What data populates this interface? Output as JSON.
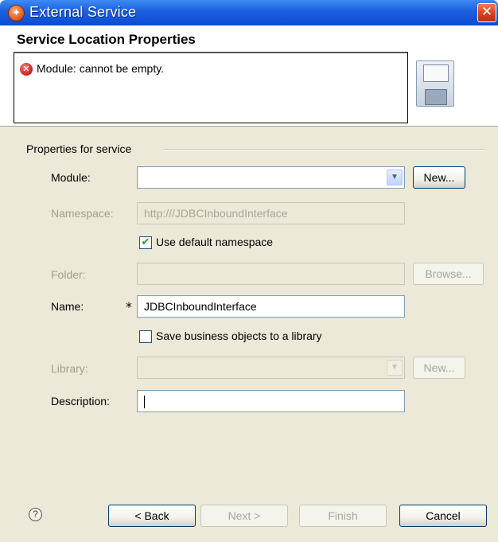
{
  "window": {
    "title": "External Service",
    "close_symbol": "✕",
    "app_icon_symbol": "✦"
  },
  "header": {
    "title": "Service Location Properties",
    "error_message": "Module: cannot be empty."
  },
  "group": {
    "label": "Properties for service"
  },
  "form": {
    "module_label": "Module:",
    "module_value": "",
    "module_new_button": "New...",
    "namespace_label": "Namespace:",
    "namespace_value": "http:///JDBCInboundInterface",
    "use_default_namespace_label": "Use default namespace",
    "use_default_namespace_checked": true,
    "folder_label": "Folder:",
    "folder_value": "",
    "browse_button": "Browse...",
    "name_label": "Name:",
    "name_required_marker": "*",
    "name_value": "JDBCInboundInterface",
    "save_bo_label": "Save business objects to a library",
    "save_bo_checked": false,
    "library_label": "Library:",
    "library_value": "",
    "library_new_button": "New...",
    "description_label": "Description:",
    "description_value": ""
  },
  "footer": {
    "help_symbol": "?",
    "back_button": "< Back",
    "next_button": "Next >",
    "finish_button": "Finish",
    "cancel_button": "Cancel"
  },
  "icons": {
    "combo_arrow": "▼",
    "check_mark": "✔",
    "error_symbol": "✕"
  }
}
